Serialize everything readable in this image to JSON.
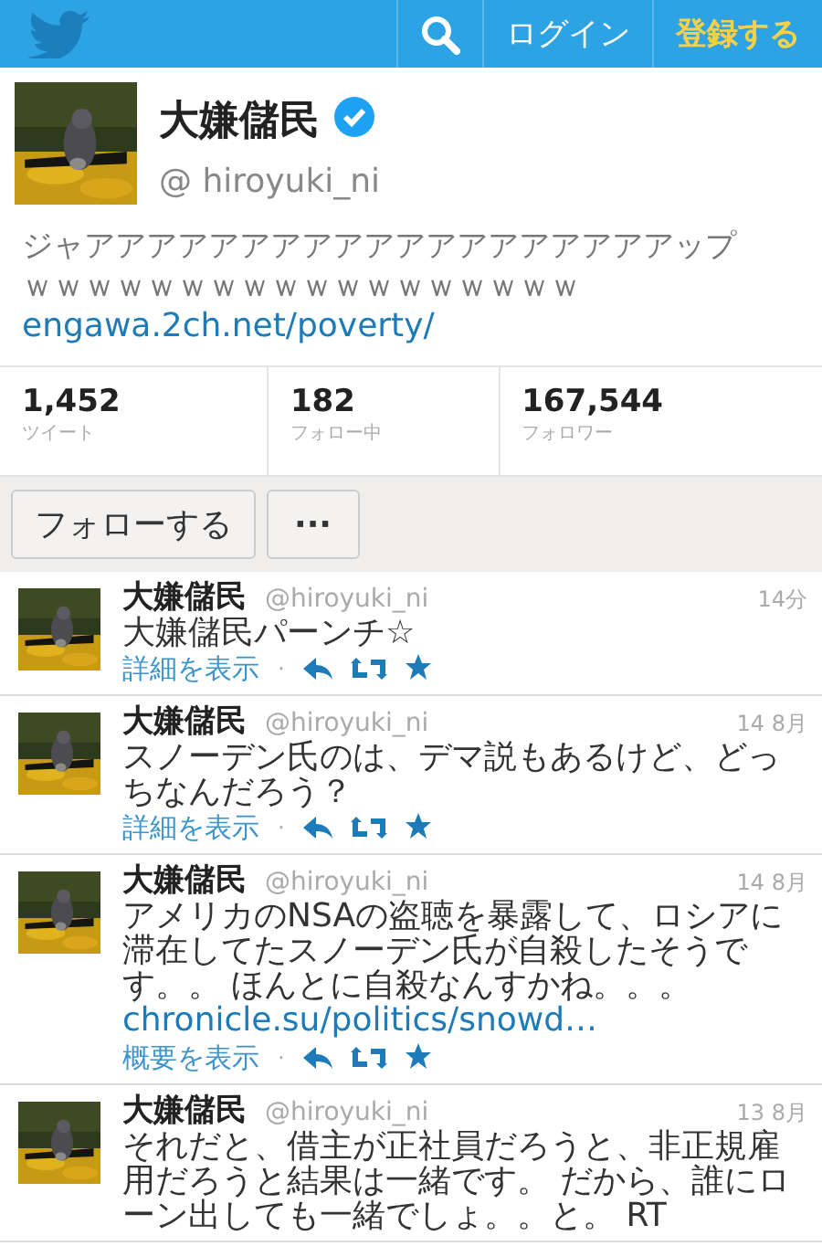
{
  "header": {
    "login": "ログイン",
    "signup": "登録する"
  },
  "profile": {
    "name": "大嫌儲民",
    "verified": true,
    "handle": "@ hiroyuki_ni",
    "bio": [
      "ジャアアアアアアアアアアアアアアアアアアアップ",
      "ｗｗｗｗｗｗｗｗｗｗｗｗｗｗｗｗｗｗ"
    ],
    "url": "engawa.2ch.net/poverty/"
  },
  "stats": [
    {
      "count": "1,452",
      "label": "ツイート"
    },
    {
      "count": "182",
      "label": "フォロー中"
    },
    {
      "count": "167,544",
      "label": "フォロワー"
    }
  ],
  "actions": {
    "follow": "フォローする",
    "more": "···"
  },
  "tweets": [
    {
      "name": "大嫌儲民",
      "handle": "@hiroyuki_ni",
      "time": "14分",
      "text": "大嫌儲民パーンチ☆",
      "detail": "詳細を表示",
      "separator": "·"
    },
    {
      "name": "大嫌儲民",
      "handle": "@hiroyuki_ni",
      "time": "14 8月",
      "text": "スノーデン氏のは、デマ説もあるけど、どっちなんだろう？",
      "detail": "詳細を表示",
      "separator": "·"
    },
    {
      "name": "大嫌儲民",
      "handle": "@hiroyuki_ni",
      "time": "14 8月",
      "text": "アメリカのNSAの盗聴を暴露して、ロシアに滞在してたスノーデン氏が自殺したそうです。。 ほんとに自殺なんすかね。。。",
      "link": "chronicle.su/politics/snowd…",
      "detail": "概要を表示",
      "separator": "·"
    },
    {
      "name": "大嫌儲民",
      "handle": "@hiroyuki_ni",
      "time": "13 8月",
      "text": "それだと、借主が正社員だろうと、非正規雇用だろうと結果は一緒です。 だから、誰にローン出しても一緒でしょ。。と。 RT"
    }
  ]
}
